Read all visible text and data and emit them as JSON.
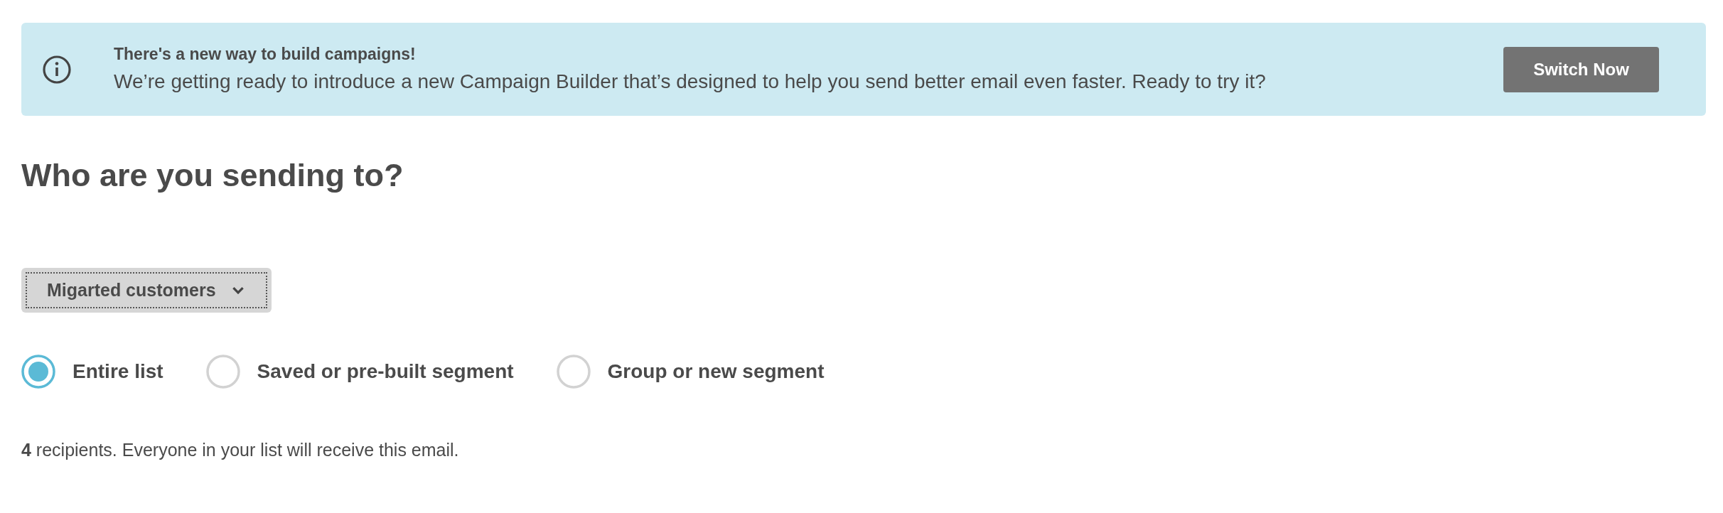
{
  "banner": {
    "title": "There's a new way to build campaigns!",
    "message": "We’re getting ready to introduce a new Campaign Builder that’s designed to help you send better email even faster. Ready to try it?",
    "button": "Switch Now"
  },
  "heading": "Who are you sending to?",
  "list_dropdown": {
    "value": "Migarted customers"
  },
  "audience_options": [
    {
      "label": "Entire list",
      "selected": true
    },
    {
      "label": "Saved or pre-built segment",
      "selected": false
    },
    {
      "label": "Group or new segment",
      "selected": false
    }
  ],
  "summary": "**4** recipients. Everyone in your list will receive this email."
}
